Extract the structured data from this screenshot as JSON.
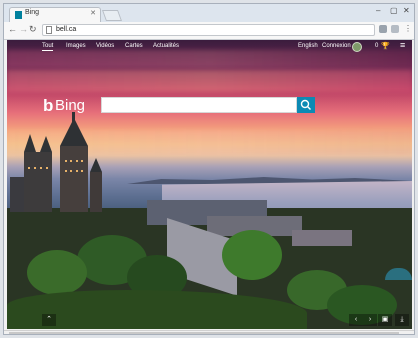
{
  "browser": {
    "tab_title": "Bing",
    "url": "bell.ca"
  },
  "bing": {
    "nav": [
      "Tout",
      "Images",
      "Vidéos",
      "Cartes",
      "Actualités"
    ],
    "language": "English",
    "signin": "Connexion",
    "rewards_count": "0",
    "logo_text": "Bing"
  }
}
